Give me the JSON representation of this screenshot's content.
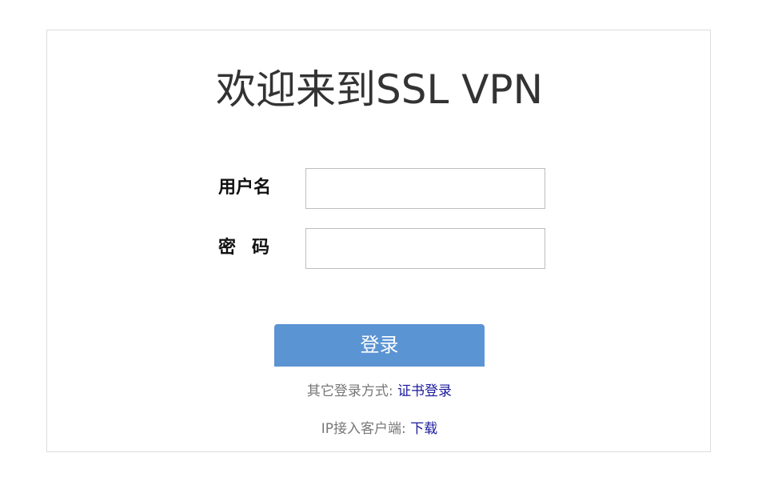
{
  "title": "欢迎来到SSL VPN",
  "form": {
    "username_label": "用户名",
    "password_label": "密码",
    "username_value": "",
    "password_value": ""
  },
  "login_button": "登录",
  "alt_login": {
    "prefix": "其它登录方式:",
    "link": "证书登录"
  },
  "client": {
    "prefix": "IP接入客户端:",
    "link": "下载"
  },
  "colors": {
    "button_bg": "#5b94d3",
    "link": "#1a1a9c",
    "title": "#333333"
  }
}
